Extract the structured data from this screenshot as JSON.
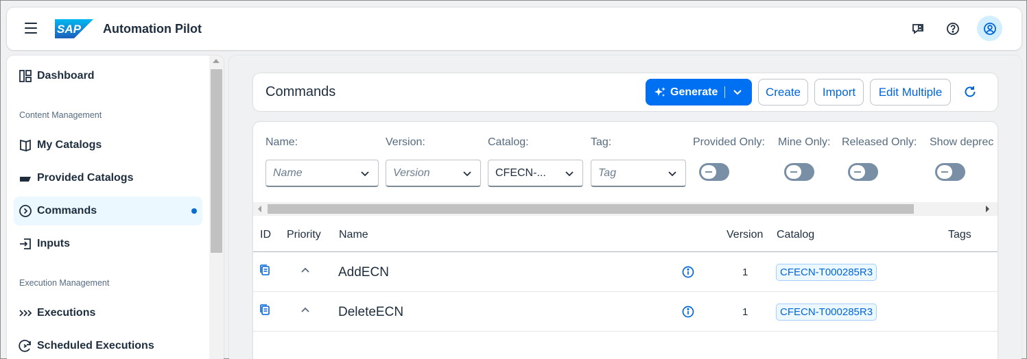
{
  "shell": {
    "app_title": "Automation Pilot",
    "logo_text": "SAP"
  },
  "sidebar": {
    "items": [
      {
        "label": "Dashboard",
        "icon": "dashboard-icon"
      },
      {
        "label": "My Catalogs",
        "icon": "catalog-icon"
      },
      {
        "label": "Provided Catalogs",
        "icon": "provided-catalog-icon"
      },
      {
        "label": "Commands",
        "icon": "command-icon",
        "active": true
      },
      {
        "label": "Inputs",
        "icon": "input-icon"
      },
      {
        "label": "Executions",
        "icon": "executions-icon"
      },
      {
        "label": "Scheduled Executions",
        "icon": "scheduled-icon"
      }
    ],
    "groups": [
      "Content Management",
      "Execution Management"
    ]
  },
  "toolbar": {
    "title": "Commands",
    "generate_label": "Generate",
    "create_label": "Create",
    "import_label": "Import",
    "edit_multiple_label": "Edit Multiple"
  },
  "filters": {
    "name": {
      "label": "Name:",
      "placeholder": "Name"
    },
    "version": {
      "label": "Version:",
      "placeholder": "Version"
    },
    "catalog": {
      "label": "Catalog:",
      "value": "CFECN-..."
    },
    "tag": {
      "label": "Tag:",
      "placeholder": "Tag"
    },
    "provided_only": {
      "label": "Provided Only:",
      "on": false
    },
    "mine_only": {
      "label": "Mine Only:",
      "on": false
    },
    "released_only": {
      "label": "Released Only:",
      "on": false
    },
    "show_deprecated": {
      "label": "Show deprec",
      "on": false
    }
  },
  "table": {
    "headers": [
      "ID",
      "Priority",
      "Name",
      "Version",
      "Catalog",
      "Tags"
    ],
    "rows": [
      {
        "name": "AddECN",
        "version": "1",
        "catalog": "CFECN-T000285R3"
      },
      {
        "name": "DeleteECN",
        "version": "1",
        "catalog": "CFECN-T000285R3"
      }
    ]
  },
  "colors": {
    "accent": "#0070f2",
    "link": "#0064d9",
    "active_nav_bg": "#ebf8ff"
  }
}
